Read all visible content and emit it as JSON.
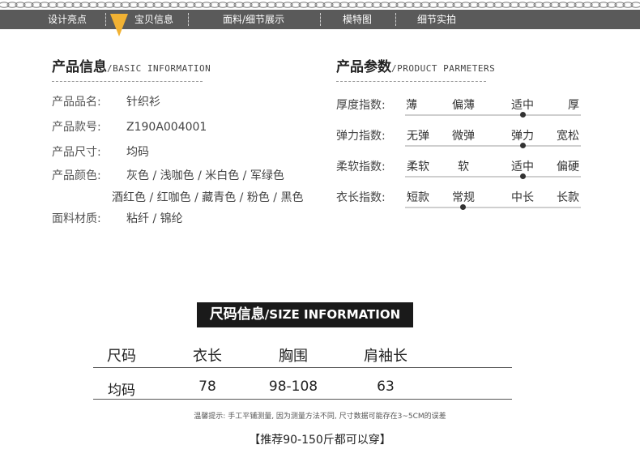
{
  "nav": {
    "items": [
      "设计亮点",
      "宝贝信息",
      "面料/细节展示",
      "模特图",
      "细节实拍"
    ]
  },
  "colors": {
    "nav_bg": "#5a5a5a",
    "accent": "#f2b233",
    "banner_bg": "#1a1a1a"
  },
  "product_info": {
    "title": "产品信息",
    "subtitle": "/BASIC INFORMATION",
    "rows": [
      {
        "label": "产品品名:",
        "value": "针织衫"
      },
      {
        "label": "产品款号:",
        "value": "Z190A004001"
      },
      {
        "label": "产品尺寸:",
        "value": "均码"
      },
      {
        "label": "产品颜色:",
        "value": "灰色 / 浅咖色 / 米白色 / 军绿色"
      },
      {
        "label": "",
        "value": "酒红色 / 红咖色 / 藏青色 / 粉色 / 黑色"
      },
      {
        "label": "面料材质:",
        "value": "粘纤  /  锦纶"
      }
    ]
  },
  "product_params": {
    "title": "产品参数",
    "subtitle": "/PRODUCT PARMETERS",
    "rows": [
      {
        "label": "厚度指数:",
        "options": [
          "薄",
          "偏薄",
          "适中",
          "厚"
        ],
        "selected": 2
      },
      {
        "label": "弹力指数:",
        "options": [
          "无弹",
          "微弹",
          "弹力",
          "宽松"
        ],
        "selected": 2
      },
      {
        "label": "柔软指数:",
        "options": [
          "柔软",
          "软",
          "适中",
          "偏硬"
        ],
        "selected": 2
      },
      {
        "label": "衣长指数:",
        "options": [
          "短款",
          "常规",
          "中长",
          "长款"
        ],
        "selected": 1
      }
    ]
  },
  "size_info": {
    "title": "尺码信息",
    "subtitle": "/SIZE INFORMATION",
    "headers": [
      "尺码",
      "衣长",
      "胸围",
      "肩袖长"
    ],
    "rows": [
      [
        "均码",
        "78",
        "98-108",
        "63"
      ]
    ],
    "note": "温馨提示: 手工平铺测量, 因为测量方法不同, 尺寸数据可能存在3~5CM的误差",
    "recommend": "【推荐90-150斤都可以穿】"
  }
}
